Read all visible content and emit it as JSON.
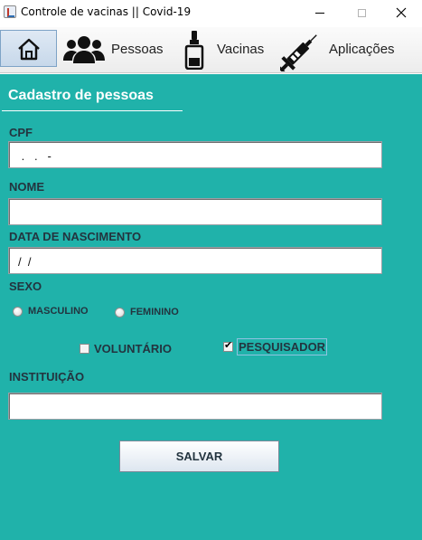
{
  "window": {
    "title": "Controle de vacinas  ||   Covid-19",
    "close_glyph": "✕"
  },
  "toolbar": {
    "home_icon": "home-icon",
    "people_label": "Pessoas",
    "vaccines_label": "Vacinas",
    "applications_label": "Aplicações"
  },
  "form": {
    "title": "Cadastro de pessoas",
    "cpf": {
      "label": "CPF",
      "value": " .   .   -"
    },
    "nome": {
      "label": "NOME",
      "value": ""
    },
    "nascimento": {
      "label": "DATA DE NASCIMENTO",
      "value": "/  /"
    },
    "sexo": {
      "label": "SEXO",
      "options": [
        "MASCULINO",
        "FEMININO"
      ],
      "selected": null
    },
    "voluntario": {
      "label": "VOLUNTÁRIO",
      "checked": false
    },
    "pesquisador": {
      "label": "PESQUISADOR",
      "checked": true
    },
    "instituicao": {
      "label": "INSTITUIÇÃO",
      "value": ""
    },
    "save_label": "SALVAR"
  },
  "colors": {
    "background": "#20b2aa",
    "label_text": "#23343f",
    "title_text": "#ffffff"
  }
}
